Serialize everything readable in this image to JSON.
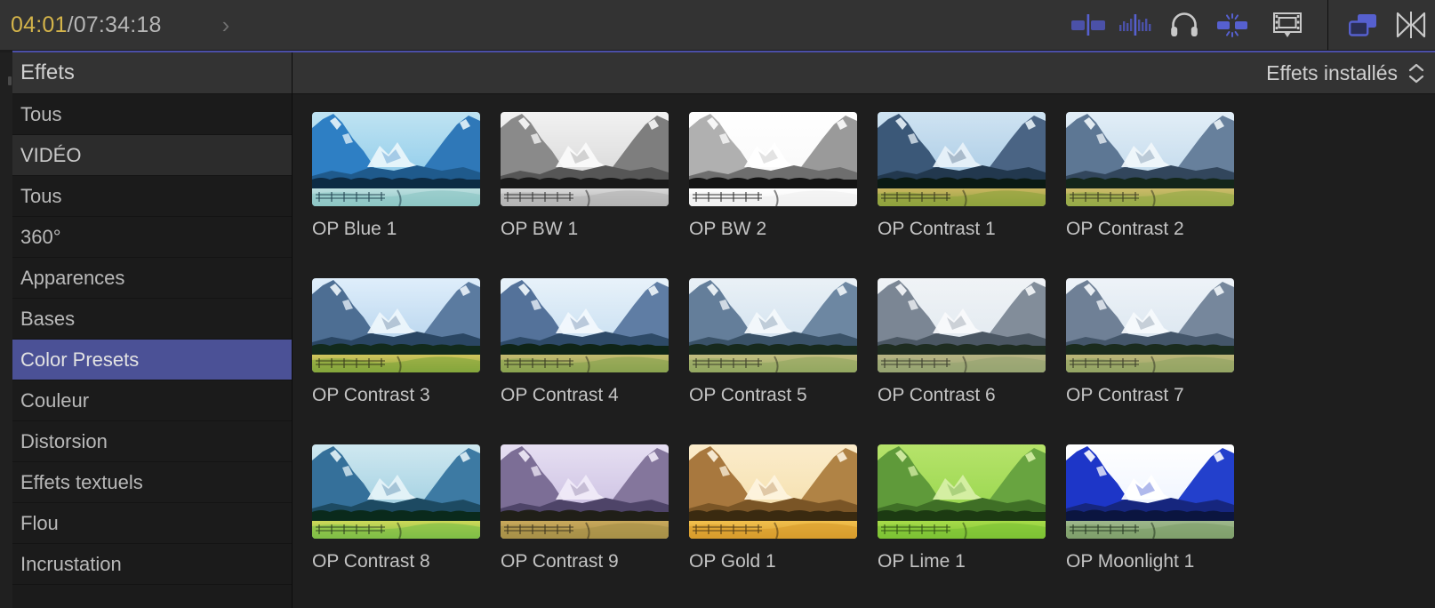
{
  "toolbar": {
    "timecode_current": "04:01",
    "timecode_rest": "/07:34:18",
    "expand_chevron": "›",
    "buttons": [
      {
        "name": "clip-skimming-icon",
        "title": "Activer/désactiver le survol des plans"
      },
      {
        "name": "audio-skimming-icon",
        "title": "Activer/désactiver le survol audio"
      },
      {
        "name": "solo-headphones-icon",
        "title": "Isoler"
      },
      {
        "name": "snapping-icon",
        "title": "Aimantation"
      },
      {
        "name": "clip-appearance-icon",
        "title": "Apparence des plans"
      },
      {
        "name": "effects-browser-icon",
        "title": "Effets"
      },
      {
        "name": "transitions-browser-icon",
        "title": "Transitions"
      }
    ]
  },
  "sidebar": {
    "title": "Effets",
    "items": [
      {
        "label": "Tous",
        "type": "item",
        "selected": false
      },
      {
        "label": "VIDÉO",
        "type": "section",
        "selected": false
      },
      {
        "label": "Tous",
        "type": "item",
        "selected": false
      },
      {
        "label": "360°",
        "type": "item",
        "selected": false
      },
      {
        "label": "Apparences",
        "type": "item",
        "selected": false
      },
      {
        "label": "Bases",
        "type": "item",
        "selected": false
      },
      {
        "label": "Color Presets",
        "type": "item",
        "selected": true
      },
      {
        "label": "Couleur",
        "type": "item",
        "selected": false
      },
      {
        "label": "Distorsion",
        "type": "item",
        "selected": false
      },
      {
        "label": "Effets textuels",
        "type": "item",
        "selected": false
      },
      {
        "label": "Flou",
        "type": "item",
        "selected": false
      },
      {
        "label": "Incrustation",
        "type": "item",
        "selected": false
      }
    ]
  },
  "browser": {
    "filter_label": "Effets installés",
    "accent_color": "#4b5196",
    "items": [
      {
        "label": "OP Blue 1",
        "grade": "blue1"
      },
      {
        "label": "OP BW 1",
        "grade": "bw1"
      },
      {
        "label": "OP BW 2",
        "grade": "bw2"
      },
      {
        "label": "OP Contrast 1",
        "grade": "contrast1"
      },
      {
        "label": "OP Contrast 2",
        "grade": "contrast2"
      },
      {
        "label": "OP Contrast 3",
        "grade": "contrast3"
      },
      {
        "label": "OP Contrast 4",
        "grade": "contrast4"
      },
      {
        "label": "OP Contrast 5",
        "grade": "contrast5"
      },
      {
        "label": "OP Contrast 6",
        "grade": "contrast6"
      },
      {
        "label": "OP Contrast 7",
        "grade": "contrast7"
      },
      {
        "label": "OP Contrast 8",
        "grade": "contrast8"
      },
      {
        "label": "OP Contrast 9",
        "grade": "contrast9"
      },
      {
        "label": "OP Gold 1",
        "grade": "gold1"
      },
      {
        "label": "OP Lime 1",
        "grade": "lime1"
      },
      {
        "label": "OP Moonlight 1",
        "grade": "moonlight1"
      }
    ]
  }
}
